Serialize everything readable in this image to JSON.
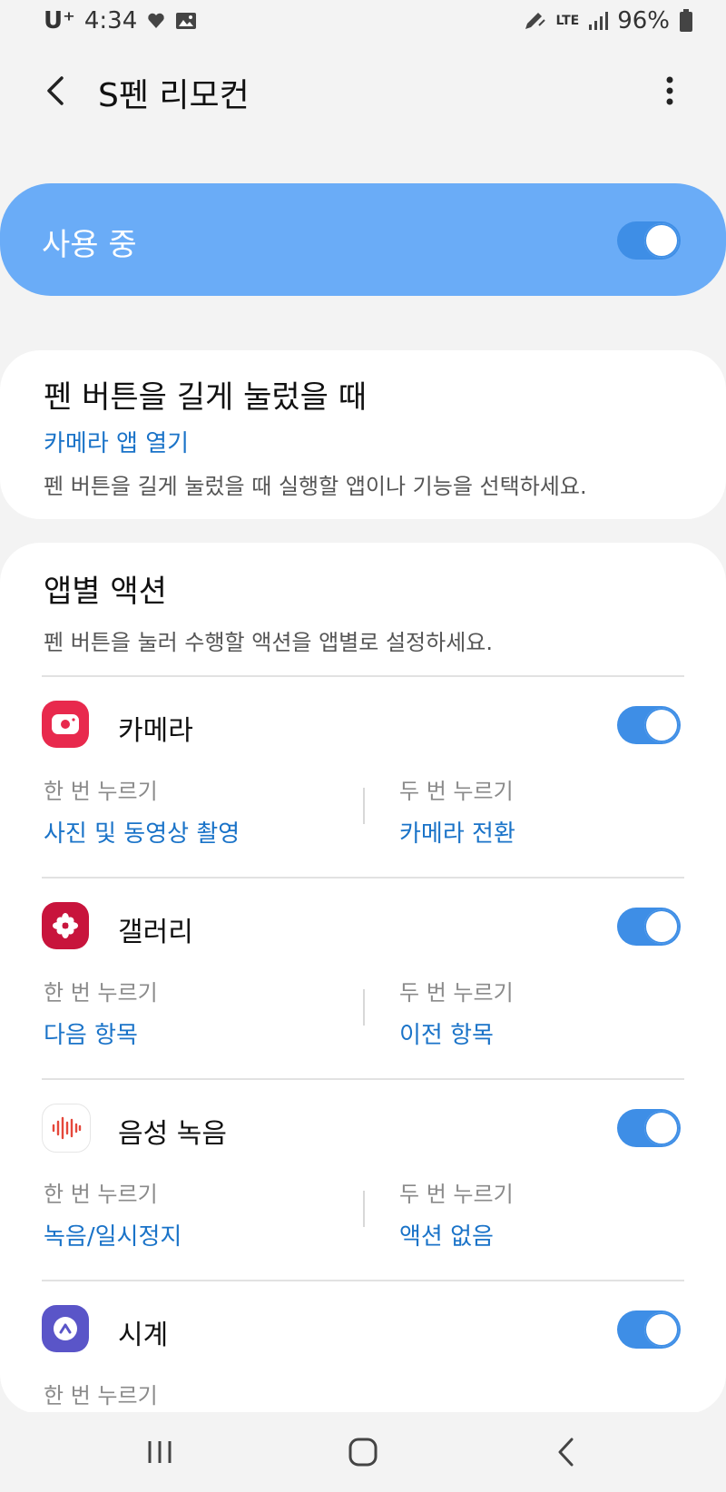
{
  "status_bar": {
    "carrier": "U⁺",
    "time": "4:34",
    "network": "LTE",
    "battery": "96%"
  },
  "app_bar": {
    "title": "S펜 리모컨"
  },
  "master_switch": {
    "label": "사용 중",
    "on": true
  },
  "long_press": {
    "title": "펜 버튼을 길게 눌렀을 때",
    "value": "카메라 앱 열기",
    "description": "펜 버튼을 길게 눌렀을 때 실행할 앱이나 기능을 선택하세요."
  },
  "app_actions": {
    "title": "앱별 액션",
    "description": "펜 버튼을 눌러 수행할 액션을 앱별로 설정하세요.",
    "apps": [
      {
        "name": "카메라",
        "icon": "camera-icon",
        "color": "#e8294d",
        "on": true,
        "single_label": "한 번 누르기",
        "single_value": "사진 및 동영상 촬영",
        "double_label": "두 번 누르기",
        "double_value": "카메라 전환"
      },
      {
        "name": "갤러리",
        "icon": "gallery-icon",
        "color": "#c8143c",
        "on": true,
        "single_label": "한 번 누르기",
        "single_value": "다음 항목",
        "double_label": "두 번 누르기",
        "double_value": "이전 항목"
      },
      {
        "name": "음성 녹음",
        "icon": "voice-recorder-icon",
        "color": "#ffffff",
        "on": true,
        "single_label": "한 번 누르기",
        "single_value": "녹음/일시정지",
        "double_label": "두 번 누르기",
        "double_value": "액션 없음"
      },
      {
        "name": "시계",
        "icon": "clock-icon",
        "color": "#5a55c8",
        "on": true,
        "single_label": "한 번 누르기"
      }
    ]
  },
  "colors": {
    "accent": "#1a73c8",
    "toggle_on": "#3e8ee6",
    "master_bg": "#6aacf7"
  }
}
